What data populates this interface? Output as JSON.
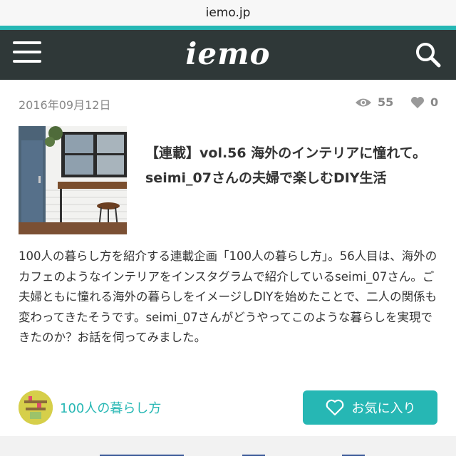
{
  "browser": {
    "url": "iemo.jp"
  },
  "header": {
    "logo": "iemo",
    "menu_icon": "hamburger-menu-icon",
    "search_icon": "search-icon"
  },
  "article": {
    "date": "2016年09月12日",
    "views": "55",
    "likes": "0",
    "title": "【連載】vol.56 海外のインテリアに憧れて。seimi_07さんの夫婦で楽しむDIY生活",
    "description": "100人の暮らし方を紹介する連載企画「100人の暮らし方」。56人目は、海外のカフェのようなインテリアをインスタグラムで紹介しているseimi_07さん。ご夫婦ともに憧れる海外の暮らしをイメージしDIYを始めたことで、二人の関係も変わってきたそうです。seimi_07さんがどうやってこのような暮らしを実現できたのか？お話を伺ってみました。"
  },
  "category": {
    "label": "100人の暮らし方"
  },
  "actions": {
    "favorite_label": "お気に入り"
  },
  "colors": {
    "accent": "#26b7b4",
    "header_bg": "#2f3838",
    "meta_text": "#888888"
  }
}
